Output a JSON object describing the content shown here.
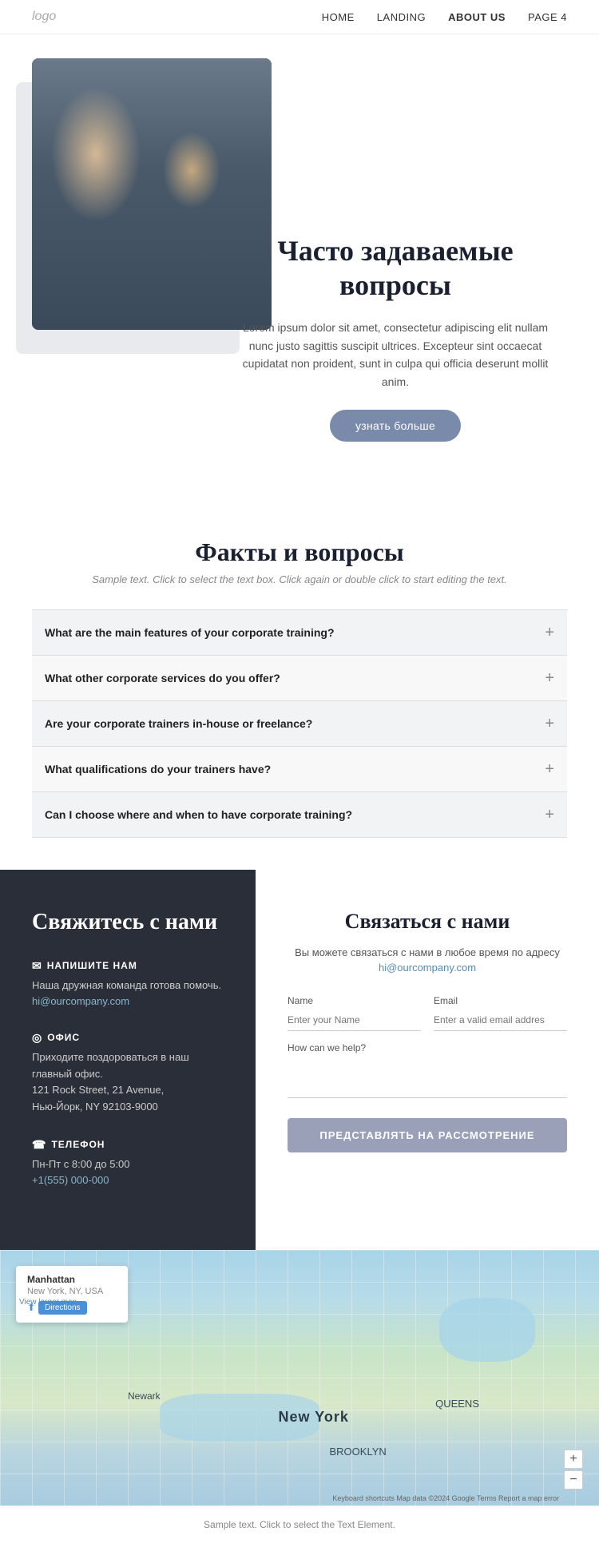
{
  "navbar": {
    "logo": "logo",
    "links": [
      {
        "label": "HOME",
        "active": false
      },
      {
        "label": "LANDING",
        "active": false
      },
      {
        "label": "ABOUT US",
        "active": true
      },
      {
        "label": "PAGE 4",
        "active": false
      }
    ]
  },
  "hero": {
    "title": "Часто задаваемые вопросы",
    "description": "Lorem ipsum dolor sit amet, consectetur adipiscing elit nullam nunc justo sagittis suscipit ultrices. Excepteur sint occaecat cupidatat non proident, sunt in culpa qui officia deserunt mollit anim.",
    "button_label": "узнать больше"
  },
  "faq": {
    "section_title": "Факты и вопросы",
    "subtitle": "Sample text. Click to select the text box. Click again or double click to start editing the text.",
    "items": [
      {
        "question": "What are the main features of your corporate training?"
      },
      {
        "question": "What other corporate services do you offer?"
      },
      {
        "question": "Are your corporate trainers in-house or freelance?"
      },
      {
        "question": "What qualifications do your trainers have?"
      },
      {
        "question": "Can I choose where and when to have corporate training?"
      }
    ]
  },
  "contact_left": {
    "title": "Свяжитесь с нами",
    "email_label": "НАПИШИТЕ НАМ",
    "email_desc": "Наша дружная команда готова помочь.",
    "email_link": "hi@ourcompany.com",
    "office_label": "ОФИС",
    "office_desc": "Приходите поздороваться в наш главный офис.",
    "office_address": "121 Rock Street, 21 Avenue,\nНью-Йорк, NY 92103-9000",
    "phone_label": "ТЕЛЕФОН",
    "phone_hours": "Пн-Пт с 8:00 до 5:00",
    "phone_number": "+1(555) 000-000"
  },
  "contact_right": {
    "title": "Связаться с нами",
    "desc": "Вы можете связаться с нами в любое время по адресу",
    "email_link": "hi@ourcompany.com",
    "name_label": "Name",
    "name_placeholder": "Enter your Name",
    "email_label": "Email",
    "email_placeholder": "Enter a valid email addres",
    "message_label": "How can we help?",
    "submit_label": "ПРЕДСТАВЛЯТЬ НА РАССМОТРЕНИЕ"
  },
  "map": {
    "popup_title": "Manhattan",
    "popup_sub": "New York, NY, USA",
    "larger_map": "View larger map",
    "directions_label": "Directions",
    "labels": {
      "new_york": "New York",
      "brooklyn": "BROOKLYN",
      "queens": "QUEENS",
      "newark": "Newark"
    },
    "credit": "Keyboard shortcuts  Map data ©2024 Google  Terms  Report a map error"
  },
  "footer": {
    "text": "Sample text. Click to select the Text Element."
  }
}
